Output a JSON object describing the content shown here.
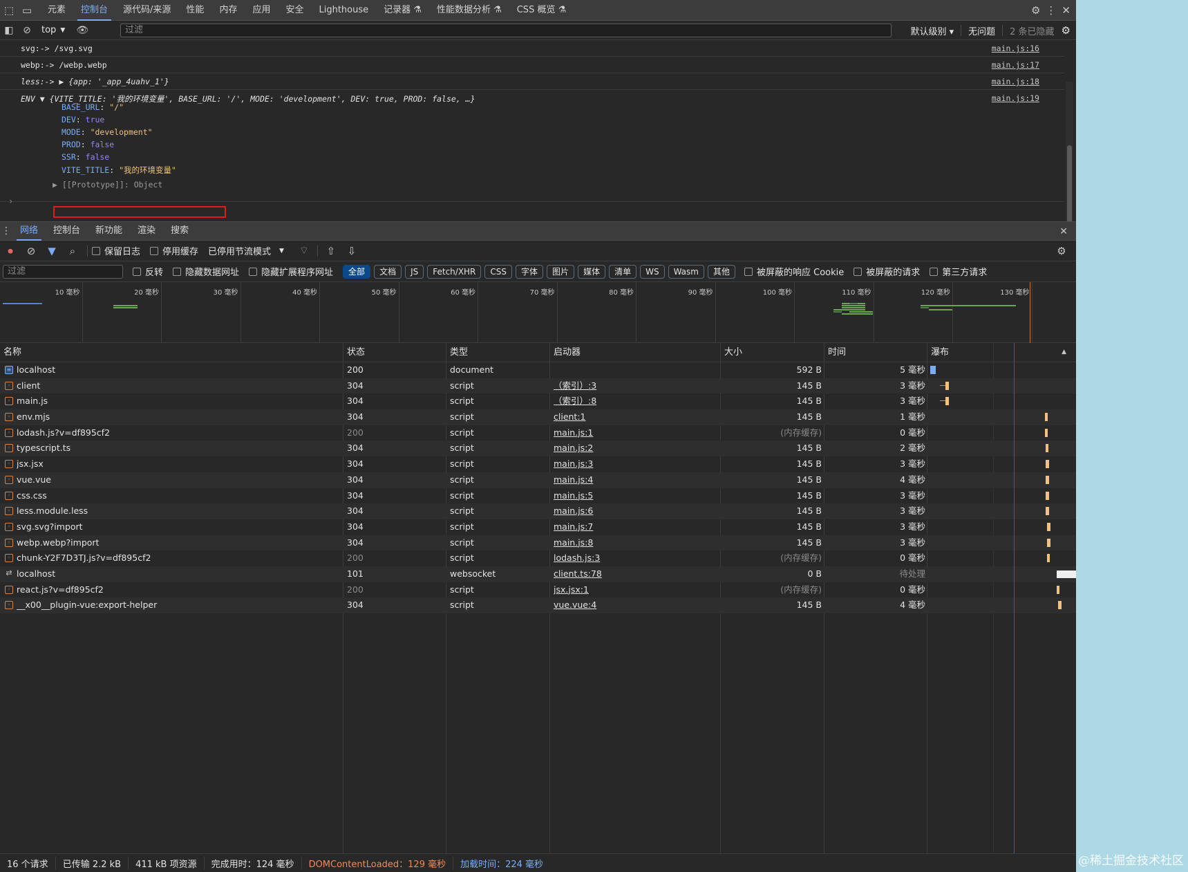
{
  "topbar": {
    "tabs": [
      "元素",
      "控制台",
      "源代码/来源",
      "性能",
      "内存",
      "应用",
      "安全",
      "Lighthouse",
      "记录器 ⚗",
      "性能数据分析 ⚗",
      "CSS 概览 ⚗"
    ],
    "active_tab": "控制台"
  },
  "console_toolbar": {
    "context": "top",
    "filter_placeholder": "过滤",
    "level": "默认级别 ▾",
    "issues": "无问题",
    "hidden": "2 条已隐藏"
  },
  "console": {
    "lines": [
      {
        "text": "svg:-> /svg.svg",
        "source": "main.js:16"
      },
      {
        "text": "webp:-> /webp.webp",
        "source": "main.js:17"
      },
      {
        "text": "less:-> ▶ {app: '_app_4uahv_1'}",
        "source": "main.js:18"
      },
      {
        "text": "ENV ▼ {VITE_TITLE: '我的环境变量', BASE_URL: '/', MODE: 'development', DEV: true, PROD: false, …}",
        "source": "main.js:19"
      }
    ],
    "env": [
      {
        "key": "BASE_URL",
        "value": "\"/\"",
        "kind": "str"
      },
      {
        "key": "DEV",
        "value": "true",
        "kind": "bool"
      },
      {
        "key": "MODE",
        "value": "\"development\"",
        "kind": "str"
      },
      {
        "key": "PROD",
        "value": "false",
        "kind": "bool"
      },
      {
        "key": "SSR",
        "value": "false",
        "kind": "bool"
      },
      {
        "key": "VITE_TITLE",
        "value": "\"我的环境变量\"",
        "kind": "str"
      }
    ],
    "prototype": "▶ [[Prototype]]: Object",
    "prompt": "›"
  },
  "drawer": {
    "tabs": [
      "网络",
      "控制台",
      "新功能",
      "渲染",
      "搜索"
    ],
    "active_tab": "网络"
  },
  "network_toolbar": {
    "preserve_log": "保留日志",
    "disable_cache": "停用缓存",
    "throttle": "已停用节流模式"
  },
  "filter_row": {
    "placeholder": "过滤",
    "invert": "反转",
    "hide_data_urls": "隐藏数据网址",
    "hide_ext_urls": "隐藏扩展程序网址",
    "types": [
      "全部",
      "文档",
      "JS",
      "Fetch/XHR",
      "CSS",
      "字体",
      "图片",
      "媒体",
      "清单",
      "WS",
      "Wasm",
      "其他"
    ],
    "active_type": "全部",
    "blocked_cookies": "被屏蔽的响应 Cookie",
    "blocked_requests": "被屏蔽的请求",
    "third_party": "第三方请求"
  },
  "overview": {
    "ticks": [
      "10 毫秒",
      "20 毫秒",
      "30 毫秒",
      "40 毫秒",
      "50 毫秒",
      "60 毫秒",
      "70 毫秒",
      "80 毫秒",
      "90 毫秒",
      "100 毫秒",
      "110 毫秒",
      "120 毫秒",
      "130 毫秒"
    ]
  },
  "table": {
    "headers": {
      "name": "名称",
      "status": "状态",
      "type": "类型",
      "initiator": "启动器",
      "size": "大小",
      "time": "时间",
      "waterfall": "瀑布"
    },
    "rows": [
      {
        "name": "localhost",
        "status": "200",
        "type": "document",
        "initiator": "",
        "size": "592 B",
        "time": "5 毫秒",
        "icon": "doc",
        "muted": false,
        "wf_start_ms": 0,
        "wf_dur_ms": 5
      },
      {
        "name": "client",
        "status": "304",
        "type": "script",
        "initiator": "（索引）:3",
        "size": "145 B",
        "time": "3 毫秒",
        "icon": "js",
        "muted": false,
        "wf_start_ms": 14,
        "wf_dur_ms": 3
      },
      {
        "name": "main.js",
        "status": "304",
        "type": "script",
        "initiator": "（索引）:8",
        "size": "145 B",
        "time": "3 毫秒",
        "icon": "js",
        "muted": false,
        "wf_start_ms": 14,
        "wf_dur_ms": 3
      },
      {
        "name": "env.mjs",
        "status": "304",
        "type": "script",
        "initiator": "client:1",
        "size": "145 B",
        "time": "1 毫秒",
        "icon": "js",
        "muted": false,
        "wf_start_ms": 105,
        "wf_dur_ms": 1
      },
      {
        "name": "lodash.js?v=df895cf2",
        "status": "200",
        "type": "script",
        "initiator": "main.js:1",
        "size": "(内存缓存)",
        "time": "0 毫秒",
        "icon": "js",
        "muted": true,
        "wf_start_ms": 105,
        "wf_dur_ms": 1
      },
      {
        "name": "typescript.ts",
        "status": "304",
        "type": "script",
        "initiator": "main.js:2",
        "size": "145 B",
        "time": "2 毫秒",
        "icon": "js",
        "muted": false,
        "wf_start_ms": 106,
        "wf_dur_ms": 2
      },
      {
        "name": "jsx.jsx",
        "status": "304",
        "type": "script",
        "initiator": "main.js:3",
        "size": "145 B",
        "time": "3 毫秒",
        "icon": "js",
        "muted": false,
        "wf_start_ms": 106,
        "wf_dur_ms": 3
      },
      {
        "name": "vue.vue",
        "status": "304",
        "type": "script",
        "initiator": "main.js:4",
        "size": "145 B",
        "time": "4 毫秒",
        "icon": "js",
        "muted": false,
        "wf_start_ms": 106,
        "wf_dur_ms": 3
      },
      {
        "name": "css.css",
        "status": "304",
        "type": "script",
        "initiator": "main.js:5",
        "size": "145 B",
        "time": "3 毫秒",
        "icon": "js",
        "muted": false,
        "wf_start_ms": 106,
        "wf_dur_ms": 3
      },
      {
        "name": "less.module.less",
        "status": "304",
        "type": "script",
        "initiator": "main.js:6",
        "size": "145 B",
        "time": "3 毫秒",
        "icon": "js",
        "muted": false,
        "wf_start_ms": 106,
        "wf_dur_ms": 3
      },
      {
        "name": "svg.svg?import",
        "status": "304",
        "type": "script",
        "initiator": "main.js:7",
        "size": "145 B",
        "time": "3 毫秒",
        "icon": "js",
        "muted": false,
        "wf_start_ms": 107,
        "wf_dur_ms": 3
      },
      {
        "name": "webp.webp?import",
        "status": "304",
        "type": "script",
        "initiator": "main.js:8",
        "size": "145 B",
        "time": "3 毫秒",
        "icon": "js",
        "muted": false,
        "wf_start_ms": 107,
        "wf_dur_ms": 3
      },
      {
        "name": "chunk-Y2F7D3TJ.js?v=df895cf2",
        "status": "200",
        "type": "script",
        "initiator": "lodash.js:3",
        "size": "(内存缓存)",
        "time": "0 毫秒",
        "icon": "js",
        "muted": true,
        "wf_start_ms": 107,
        "wf_dur_ms": 1
      },
      {
        "name": "localhost",
        "status": "101",
        "type": "websocket",
        "initiator": "client.ts:78",
        "size": "0 B",
        "time": "待处理",
        "icon": "ws",
        "muted": false,
        "wf_start_ms": 116,
        "wf_dur_ms": 999
      },
      {
        "name": "react.js?v=df895cf2",
        "status": "200",
        "type": "script",
        "initiator": "jsx.jsx:1",
        "size": "(内存缓存)",
        "time": "0 毫秒",
        "icon": "js",
        "muted": true,
        "wf_start_ms": 116,
        "wf_dur_ms": 1
      },
      {
        "name": "__x00__plugin-vue:export-helper",
        "status": "304",
        "type": "script",
        "initiator": "vue.vue:4",
        "size": "145 B",
        "time": "4 毫秒",
        "icon": "js",
        "muted": false,
        "wf_start_ms": 117,
        "wf_dur_ms": 3
      }
    ]
  },
  "statusbar": {
    "requests": "16 个请求",
    "transferred": "已传输 2.2 kB",
    "resources": "411 kB 项资源",
    "finish": "完成用时：124 毫秒",
    "dcl": "DOMContentLoaded：129 毫秒",
    "load": "加载时间：224 毫秒"
  },
  "watermark": "@稀土掘金技术社区",
  "colors": {
    "accent": "#7cacf8",
    "highlight_box": "#e01b1b",
    "dcl": "#f28b54",
    "js_icon": "#d9823b"
  }
}
